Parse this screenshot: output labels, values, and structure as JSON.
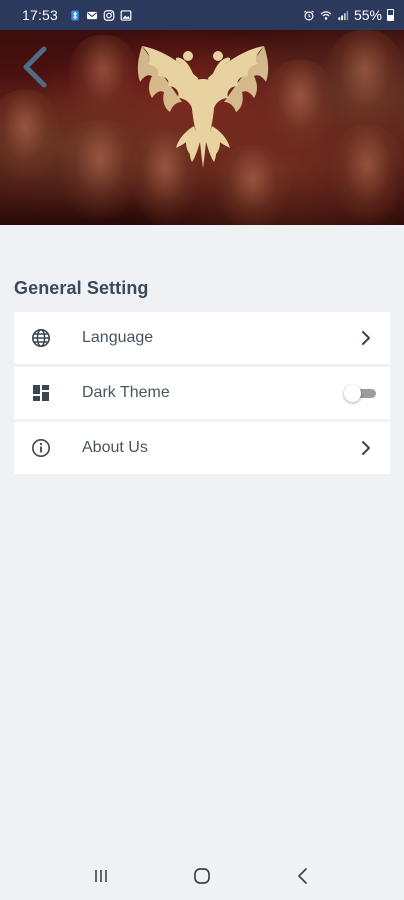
{
  "status_bar": {
    "time": "17:53",
    "battery_percent": "55%",
    "left_icons": [
      "bluetooth-icon",
      "mail-icon",
      "instagram-icon",
      "image-icon"
    ],
    "right_icons": [
      "alarm-icon",
      "wifi-icon",
      "signal-icon",
      "battery-icon"
    ]
  },
  "header": {
    "back_icon": "chevron-left-icon",
    "emblem": "double-headed-eagle"
  },
  "section": {
    "title": "General Setting"
  },
  "settings": [
    {
      "label": "Language",
      "icon": "globe-icon",
      "control": "chevron-right-icon"
    },
    {
      "label": "Dark Theme",
      "icon": "dashboard-icon",
      "control": "toggle",
      "toggle_on": false
    },
    {
      "label": "About Us",
      "icon": "info-icon",
      "control": "chevron-right-icon"
    }
  ],
  "nav_bar": {
    "items": [
      "recent-apps-icon",
      "home-icon",
      "back-icon"
    ]
  },
  "colors": {
    "status_bar_bg": "#2b3a5c",
    "page_bg": "#eff1f4",
    "card_bg": "#ffffff",
    "title_text": "#3a4a5c",
    "row_text": "#4a5560",
    "back_chevron": "#4f6b86",
    "eagle_gold": "#e8d3a0"
  }
}
